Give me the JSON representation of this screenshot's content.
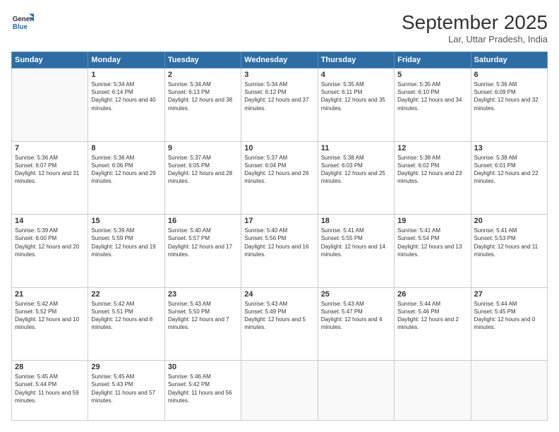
{
  "header": {
    "logo_line1": "General",
    "logo_line2": "Blue",
    "month_title": "September 2025",
    "location": "Lar, Uttar Pradesh, India"
  },
  "weekdays": [
    "Sunday",
    "Monday",
    "Tuesday",
    "Wednesday",
    "Thursday",
    "Friday",
    "Saturday"
  ],
  "weeks": [
    [
      {
        "day": "",
        "sunrise": "",
        "sunset": "",
        "daylight": ""
      },
      {
        "day": "1",
        "sunrise": "Sunrise: 5:34 AM",
        "sunset": "Sunset: 6:14 PM",
        "daylight": "Daylight: 12 hours and 40 minutes."
      },
      {
        "day": "2",
        "sunrise": "Sunrise: 5:34 AM",
        "sunset": "Sunset: 6:13 PM",
        "daylight": "Daylight: 12 hours and 38 minutes."
      },
      {
        "day": "3",
        "sunrise": "Sunrise: 5:34 AM",
        "sunset": "Sunset: 6:12 PM",
        "daylight": "Daylight: 12 hours and 37 minutes."
      },
      {
        "day": "4",
        "sunrise": "Sunrise: 5:35 AM",
        "sunset": "Sunset: 6:11 PM",
        "daylight": "Daylight: 12 hours and 35 minutes."
      },
      {
        "day": "5",
        "sunrise": "Sunrise: 5:35 AM",
        "sunset": "Sunset: 6:10 PM",
        "daylight": "Daylight: 12 hours and 34 minutes."
      },
      {
        "day": "6",
        "sunrise": "Sunrise: 5:36 AM",
        "sunset": "Sunset: 6:09 PM",
        "daylight": "Daylight: 12 hours and 32 minutes."
      }
    ],
    [
      {
        "day": "7",
        "sunrise": "Sunrise: 5:36 AM",
        "sunset": "Sunset: 6:07 PM",
        "daylight": "Daylight: 12 hours and 31 minutes."
      },
      {
        "day": "8",
        "sunrise": "Sunrise: 5:36 AM",
        "sunset": "Sunset: 6:06 PM",
        "daylight": "Daylight: 12 hours and 29 minutes."
      },
      {
        "day": "9",
        "sunrise": "Sunrise: 5:37 AM",
        "sunset": "Sunset: 6:05 PM",
        "daylight": "Daylight: 12 hours and 28 minutes."
      },
      {
        "day": "10",
        "sunrise": "Sunrise: 5:37 AM",
        "sunset": "Sunset: 6:04 PM",
        "daylight": "Daylight: 12 hours and 26 minutes."
      },
      {
        "day": "11",
        "sunrise": "Sunrise: 5:38 AM",
        "sunset": "Sunset: 6:03 PM",
        "daylight": "Daylight: 12 hours and 25 minutes."
      },
      {
        "day": "12",
        "sunrise": "Sunrise: 5:38 AM",
        "sunset": "Sunset: 6:02 PM",
        "daylight": "Daylight: 12 hours and 23 minutes."
      },
      {
        "day": "13",
        "sunrise": "Sunrise: 5:38 AM",
        "sunset": "Sunset: 6:01 PM",
        "daylight": "Daylight: 12 hours and 22 minutes."
      }
    ],
    [
      {
        "day": "14",
        "sunrise": "Sunrise: 5:39 AM",
        "sunset": "Sunset: 6:00 PM",
        "daylight": "Daylight: 12 hours and 20 minutes."
      },
      {
        "day": "15",
        "sunrise": "Sunrise: 5:39 AM",
        "sunset": "Sunset: 5:59 PM",
        "daylight": "Daylight: 12 hours and 19 minutes."
      },
      {
        "day": "16",
        "sunrise": "Sunrise: 5:40 AM",
        "sunset": "Sunset: 5:57 PM",
        "daylight": "Daylight: 12 hours and 17 minutes."
      },
      {
        "day": "17",
        "sunrise": "Sunrise: 5:40 AM",
        "sunset": "Sunset: 5:56 PM",
        "daylight": "Daylight: 12 hours and 16 minutes."
      },
      {
        "day": "18",
        "sunrise": "Sunrise: 5:41 AM",
        "sunset": "Sunset: 5:55 PM",
        "daylight": "Daylight: 12 hours and 14 minutes."
      },
      {
        "day": "19",
        "sunrise": "Sunrise: 5:41 AM",
        "sunset": "Sunset: 5:54 PM",
        "daylight": "Daylight: 12 hours and 13 minutes."
      },
      {
        "day": "20",
        "sunrise": "Sunrise: 5:41 AM",
        "sunset": "Sunset: 5:53 PM",
        "daylight": "Daylight: 12 hours and 11 minutes."
      }
    ],
    [
      {
        "day": "21",
        "sunrise": "Sunrise: 5:42 AM",
        "sunset": "Sunset: 5:52 PM",
        "daylight": "Daylight: 12 hours and 10 minutes."
      },
      {
        "day": "22",
        "sunrise": "Sunrise: 5:42 AM",
        "sunset": "Sunset: 5:51 PM",
        "daylight": "Daylight: 12 hours and 8 minutes."
      },
      {
        "day": "23",
        "sunrise": "Sunrise: 5:43 AM",
        "sunset": "Sunset: 5:50 PM",
        "daylight": "Daylight: 12 hours and 7 minutes."
      },
      {
        "day": "24",
        "sunrise": "Sunrise: 5:43 AM",
        "sunset": "Sunset: 5:49 PM",
        "daylight": "Daylight: 12 hours and 5 minutes."
      },
      {
        "day": "25",
        "sunrise": "Sunrise: 5:43 AM",
        "sunset": "Sunset: 5:47 PM",
        "daylight": "Daylight: 12 hours and 4 minutes."
      },
      {
        "day": "26",
        "sunrise": "Sunrise: 5:44 AM",
        "sunset": "Sunset: 5:46 PM",
        "daylight": "Daylight: 12 hours and 2 minutes."
      },
      {
        "day": "27",
        "sunrise": "Sunrise: 5:44 AM",
        "sunset": "Sunset: 5:45 PM",
        "daylight": "Daylight: 12 hours and 0 minutes."
      }
    ],
    [
      {
        "day": "28",
        "sunrise": "Sunrise: 5:45 AM",
        "sunset": "Sunset: 5:44 PM",
        "daylight": "Daylight: 11 hours and 59 minutes."
      },
      {
        "day": "29",
        "sunrise": "Sunrise: 5:45 AM",
        "sunset": "Sunset: 5:43 PM",
        "daylight": "Daylight: 11 hours and 57 minutes."
      },
      {
        "day": "30",
        "sunrise": "Sunrise: 5:46 AM",
        "sunset": "Sunset: 5:42 PM",
        "daylight": "Daylight: 11 hours and 56 minutes."
      },
      {
        "day": "",
        "sunrise": "",
        "sunset": "",
        "daylight": ""
      },
      {
        "day": "",
        "sunrise": "",
        "sunset": "",
        "daylight": ""
      },
      {
        "day": "",
        "sunrise": "",
        "sunset": "",
        "daylight": ""
      },
      {
        "day": "",
        "sunrise": "",
        "sunset": "",
        "daylight": ""
      }
    ]
  ]
}
